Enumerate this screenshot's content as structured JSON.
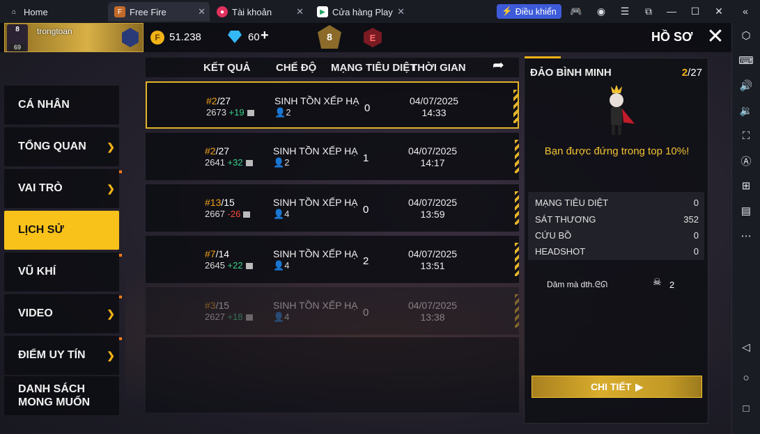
{
  "tabs": [
    {
      "label": "Home"
    },
    {
      "label": "Free Fire"
    },
    {
      "label": "Tài khoản"
    },
    {
      "label": "Cửa hàng Play"
    }
  ],
  "controls_label": "Điều khiển",
  "hud": {
    "player_name": "trongtoan",
    "level_top": "8",
    "level_bottom": "69",
    "coins": "51.238",
    "diamonds": "60",
    "rank_number": "8",
    "rank_letter": "E",
    "profile_title": "HỒ SƠ"
  },
  "nav": [
    {
      "label": "CÁ NHÂN",
      "has_chevron": false
    },
    {
      "label": "TỔNG QUAN",
      "has_chevron": true
    },
    {
      "label": "VAI TRÒ",
      "has_chevron": true
    },
    {
      "label": "LỊCH SỬ",
      "has_chevron": false
    },
    {
      "label": "VŨ KHÍ",
      "has_chevron": false
    },
    {
      "label": "VIDEO",
      "has_chevron": true
    },
    {
      "label": "ĐIỂM UY TÍN",
      "has_chevron": true
    },
    {
      "label": "DANH SÁCH\nMONG MUỐN",
      "has_chevron": false
    }
  ],
  "table": {
    "headers": {
      "result": "KẾT QUẢ",
      "mode": "CHẾ ĐỘ",
      "kills": "MẠNG TIÊU DIỆT",
      "time": "THỜI GIAN"
    },
    "rows": [
      {
        "rank": "#2",
        "total": "/27",
        "points": "2673",
        "delta": "+19",
        "mode": "SINH TỒN XẾP HẠ",
        "team": "2",
        "kills": "0",
        "date": "04/07/2025",
        "time": "14:33"
      },
      {
        "rank": "#2",
        "total": "/27",
        "points": "2641",
        "delta": "+32",
        "mode": "SINH TỒN XẾP HẠ",
        "team": "2",
        "kills": "1",
        "date": "04/07/2025",
        "time": "14:17"
      },
      {
        "rank": "#13",
        "total": "/15",
        "points": "2667",
        "delta": "-26",
        "mode": "SINH TỒN XẾP HẠ",
        "team": "4",
        "kills": "0",
        "date": "04/07/2025",
        "time": "13:59"
      },
      {
        "rank": "#7",
        "total": "/14",
        "points": "2645",
        "delta": "+22",
        "mode": "SINH TỒN XẾP HẠ",
        "team": "4",
        "kills": "2",
        "date": "04/07/2025",
        "time": "13:51"
      },
      {
        "rank": "#3",
        "total": "/15",
        "points": "2627",
        "delta": "+18",
        "mode": "SINH TỒN XẾP HẠ",
        "team": "4",
        "kills": "0",
        "date": "04/07/2025",
        "time": "13:38"
      }
    ]
  },
  "detail": {
    "map_name": "ĐẢO BÌNH MINH",
    "position": "2",
    "position_total": "/27",
    "top_message": "Bạn được đứng trong top 10%!",
    "stats": [
      {
        "label": "MẠNG TIÊU DIỆT",
        "value": "0"
      },
      {
        "label": "SÁT THƯƠNG",
        "value": "352"
      },
      {
        "label": "CỨU BỒ",
        "value": "0"
      },
      {
        "label": "HEADSHOT",
        "value": "0"
      }
    ],
    "teammate_name": "Dâm mà dth.ᘓᘏ",
    "teammate_count": "2",
    "detail_button": "CHI TIẾT"
  },
  "colors": {
    "accent": "#f9c21a",
    "positive": "#39d38a",
    "negative": "#ff4a3a",
    "controls_btn": "#3d5bd9"
  }
}
